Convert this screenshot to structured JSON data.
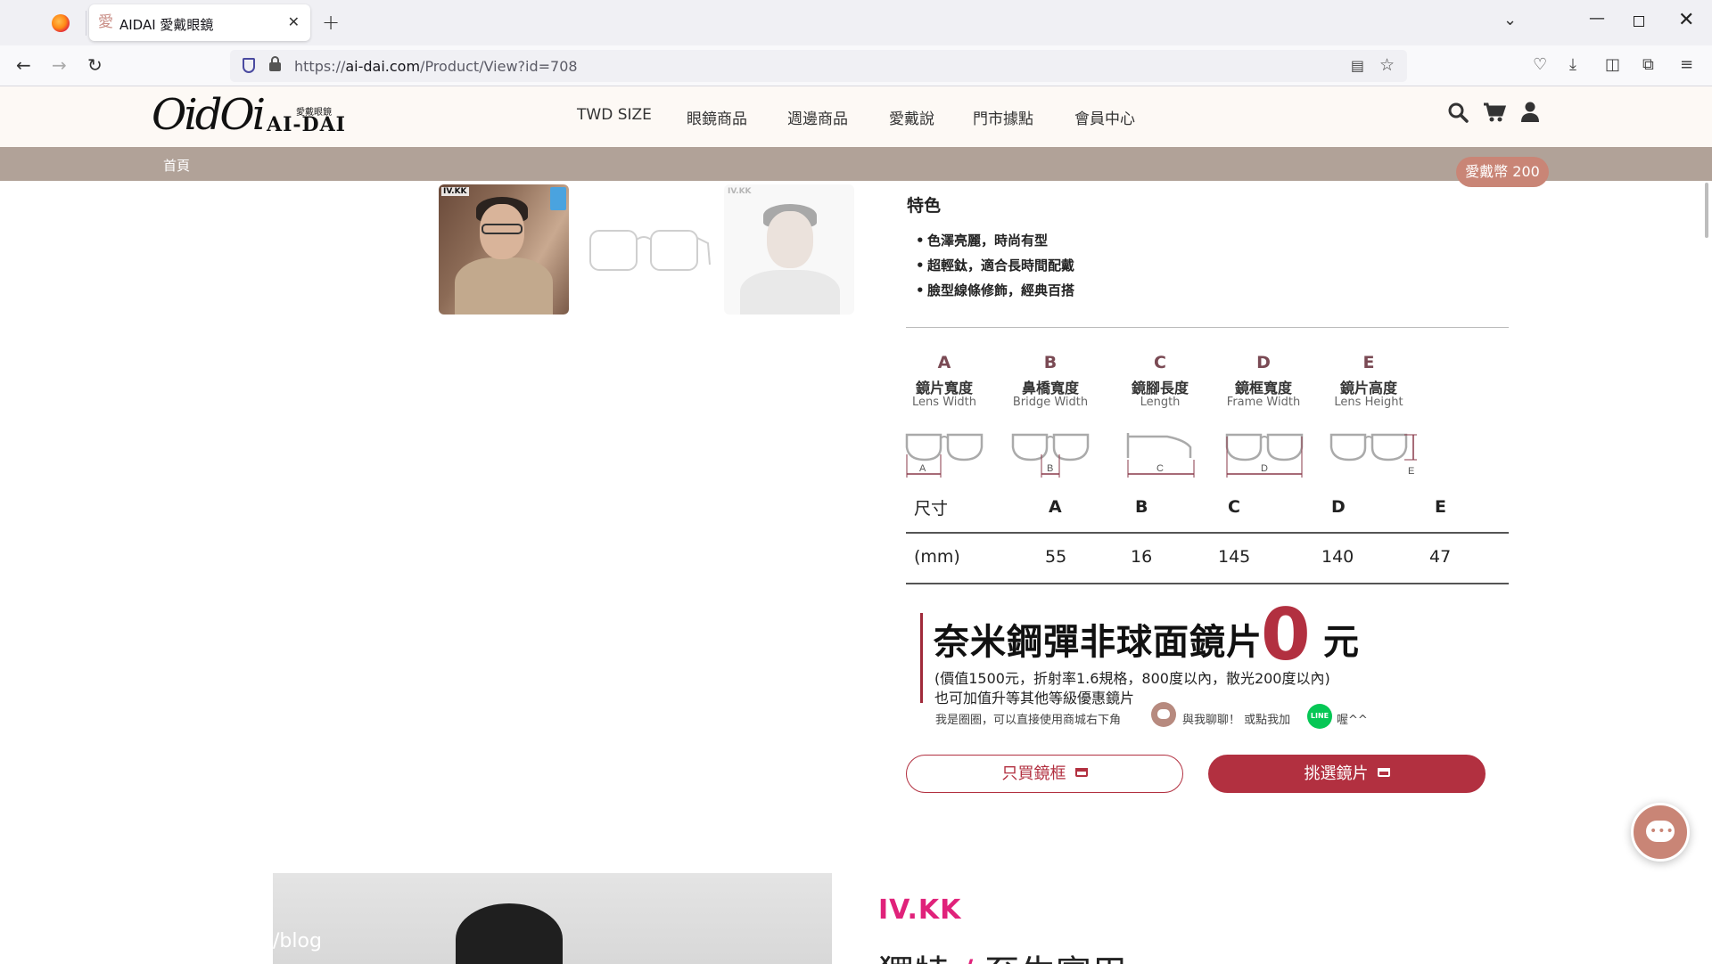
{
  "browser": {
    "tab_title": "AIDAI 愛戴眼鏡",
    "tab_favicon": "愛",
    "url_prefix": "https://",
    "url_host": "ai-dai.com",
    "url_path": "/Product/View?id=708"
  },
  "header": {
    "logo_script": "OidOi",
    "logo_cn": "愛戴眼鏡",
    "logo_en": "AI-DAI",
    "menu": [
      "TWD SIZE",
      "眼鏡商品",
      "週邊商品",
      "愛戴說",
      "門市據點",
      "會員中心"
    ]
  },
  "breadcrumb": "首頁",
  "coins": "愛戴幣 200",
  "thumbnails": {
    "badge": "IV.KK"
  },
  "features": {
    "title": "特色",
    "items": [
      "色澤亮麗，時尚有型",
      "超輕鈦，適合長時間配戴",
      "臉型線條修飾，經典百搭"
    ]
  },
  "dimensions": [
    {
      "letter": "A",
      "cn": "鏡片寬度",
      "en": "Lens Width"
    },
    {
      "letter": "B",
      "cn": "鼻橋寬度",
      "en": "Bridge Width"
    },
    {
      "letter": "C",
      "cn": "鏡腳長度",
      "en": "Length"
    },
    {
      "letter": "D",
      "cn": "鏡框寬度",
      "en": "Frame Width"
    },
    {
      "letter": "E",
      "cn": "鏡片高度",
      "en": "Lens Height"
    }
  ],
  "size_table": {
    "head_label": "尺寸",
    "unit_label": "(mm)",
    "columns": [
      "A",
      "B",
      "C",
      "D",
      "E"
    ],
    "values": [
      "55",
      "16",
      "145",
      "140",
      "47"
    ]
  },
  "promo": {
    "main": "奈米鋼彈非球面鏡片",
    "zero": "0",
    "unit": "元",
    "sub1": "(價值1500元，折射率1.6規格，800度以內，散光200度以內)",
    "sub2": "也可加值升等其他等級優惠鏡片",
    "note1": "我是圈圈，可以直接使用商城右下角",
    "note2": "與我聊聊！ 或點我加",
    "note3": "喔^^",
    "line_label": "LINE"
  },
  "buttons": {
    "frame_only": "只買鏡框",
    "choose_lens": "挑選鏡片"
  },
  "bottom": {
    "blog": "/blog",
    "brand": "IV.KK",
    "heading_left": "獨特",
    "heading_slash": "/",
    "heading_right": "至生實用"
  },
  "colors": {
    "accent": "#b23040",
    "breadcrumb_bg": "#b1a298",
    "coins_bg": "#c98576",
    "brand_pink": "#e0227a"
  }
}
